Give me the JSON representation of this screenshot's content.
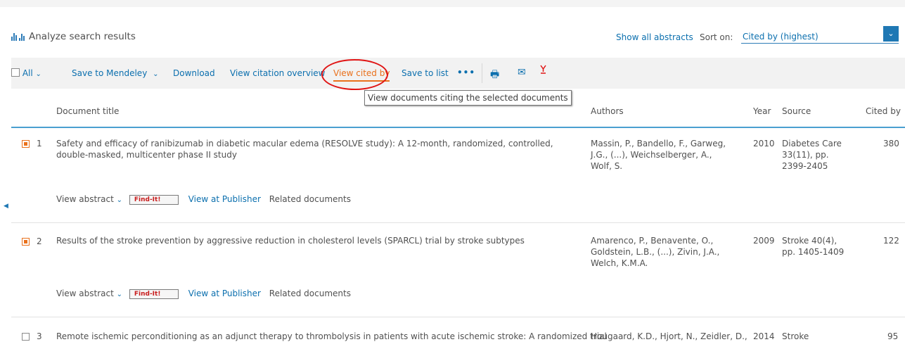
{
  "header": {
    "analyze_label": "Analyze search results",
    "show_abstracts": "Show all abstracts",
    "sort_label": "Sort on:",
    "sort_value": "Cited by (highest)"
  },
  "toolbar": {
    "all": "All",
    "save_mendeley": "Save to Mendeley",
    "download": "Download",
    "view_citation_overview": "View citation overview",
    "view_cited_by": "View cited by",
    "save_to_list": "Save to list",
    "more": "•••",
    "print_icon": "🖶",
    "email_icon": "✉",
    "pdf_icon": "pdf-icon"
  },
  "tooltip": "View documents citing the selected documents",
  "columns": {
    "title": "Document title",
    "authors": "Authors",
    "year": "Year",
    "source": "Source",
    "cited": "Cited by"
  },
  "rows": [
    {
      "num": "1",
      "title": "Safety and efficacy of ranibizumab in diabetic macular edema (RESOLVE study): A 12-month, randomized, controlled, double-masked, multicenter phase II study",
      "authors": "Massin, P., Bandello, F., Garweg, J.G., (...), Weichselberger, A., Wolf, S.",
      "year": "2010",
      "source": "Diabetes Care 33(11), pp. 2399-2405",
      "cited": "380",
      "view_abstract": "View abstract",
      "findit": "Find-It!",
      "view_publisher": "View at Publisher",
      "related": "Related documents"
    },
    {
      "num": "2",
      "title": "Results of the stroke prevention by aggressive reduction in cholesterol levels (SPARCL) trial by stroke subtypes",
      "authors": "Amarenco, P., Benavente, O., Goldstein, L.B., (...), Zivin, J.A., Welch, K.M.A.",
      "year": "2009",
      "source": "Stroke 40(4), pp. 1405-1409",
      "cited": "122",
      "view_abstract": "View abstract",
      "findit": "Find-It!",
      "view_publisher": "View at Publisher",
      "related": "Related documents"
    },
    {
      "num": "3",
      "title": "Remote ischemic perconditioning as an adjunct therapy to thrombolysis in patients with acute ischemic stroke: A randomized trial",
      "authors": "Hougaard, K.D., Hjort, N., Zeidler, D.,",
      "year": "2014",
      "source": "Stroke",
      "cited": "95"
    }
  ],
  "colors": {
    "accent": "#e9711c",
    "link": "#0b6fae",
    "annotation": "#e01414"
  }
}
